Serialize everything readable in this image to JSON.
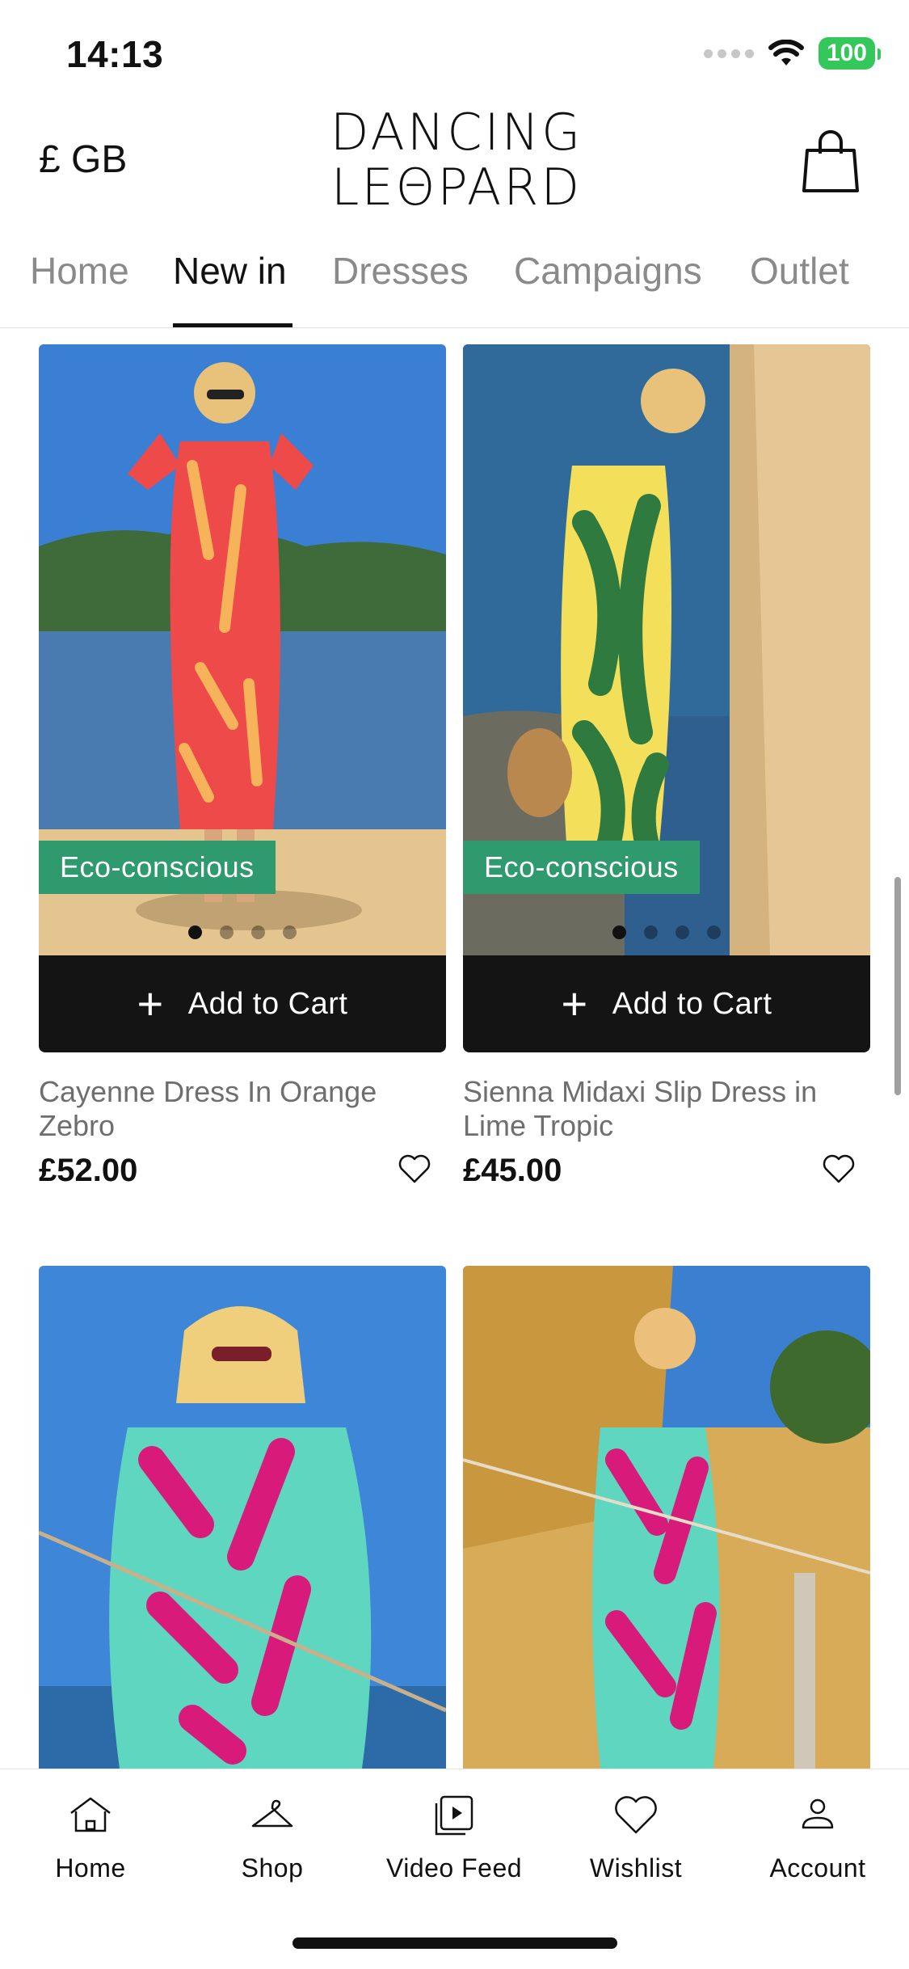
{
  "status_bar": {
    "time": "14:13",
    "battery": "100"
  },
  "header": {
    "currency": "£ GB",
    "logo_line1": "DANCING",
    "logo_line2": "LEΘPARD"
  },
  "tabs": [
    {
      "label": "Home"
    },
    {
      "label": "New in"
    },
    {
      "label": "Dresses"
    },
    {
      "label": "Campaigns"
    },
    {
      "label": "Outlet"
    }
  ],
  "products": [
    {
      "name": "Cayenne Dress In Orange Zebro",
      "price": "£52.00",
      "badge": "Eco-conscious",
      "cart_label": "Add to Cart"
    },
    {
      "name": "Sienna Midaxi Slip Dress in Lime Tropic",
      "price": "£45.00",
      "badge": "Eco-conscious",
      "cart_label": "Add to Cart"
    }
  ],
  "bottom_nav": [
    {
      "label": "Home",
      "icon": "home-icon"
    },
    {
      "label": "Shop",
      "icon": "hanger-icon"
    },
    {
      "label": "Video Feed",
      "icon": "video-feed-icon"
    },
    {
      "label": "Wishlist",
      "icon": "heart-icon"
    },
    {
      "label": "Account",
      "icon": "person-icon"
    }
  ],
  "colors": {
    "eco_badge": "#2f9a6e",
    "cart_button": "#141414",
    "battery": "#34c759"
  }
}
